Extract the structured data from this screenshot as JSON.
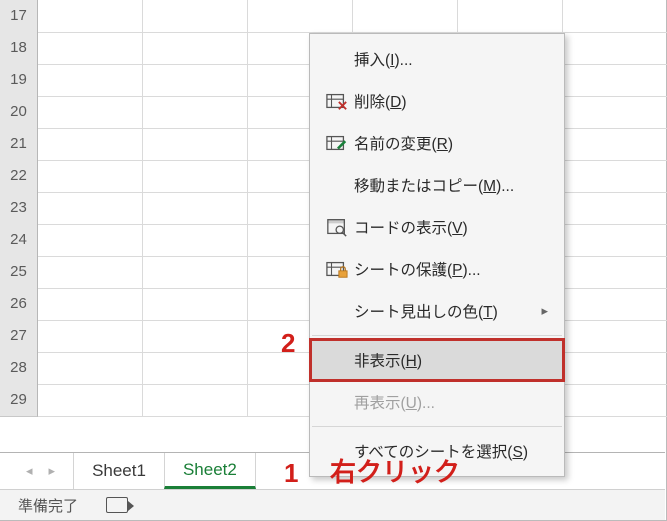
{
  "rows": [
    "17",
    "18",
    "19",
    "20",
    "21",
    "22",
    "23",
    "24",
    "25",
    "26",
    "27",
    "28",
    "29"
  ],
  "tabs": {
    "nav_prev": "◂",
    "nav_next": "▸",
    "items": [
      "Sheet1",
      "Sheet2"
    ],
    "active_index": 1
  },
  "status": {
    "ready": "準備完了"
  },
  "menu": {
    "insert": "挿入(I)...",
    "delete": "削除(D)",
    "rename": "名前の変更(R)",
    "move_copy": "移動またはコピー(M)...",
    "view_code": "コードの表示(V)",
    "protect_sheet": "シートの保護(P)...",
    "tab_color": "シート見出しの色(T)",
    "hide": "非表示(H)",
    "unhide": "再表示(U)...",
    "select_all": "すべてのシートを選択(S)"
  },
  "underline_key": {
    "insert": "I",
    "delete": "D",
    "rename": "R",
    "move_copy": "M",
    "view_code": "V",
    "protect_sheet": "P",
    "tab_color": "T",
    "hide": "H",
    "unhide": "U",
    "select_all": "S"
  },
  "annotations": {
    "n1": "1",
    "n1_text": "右クリック",
    "n2": "2"
  }
}
